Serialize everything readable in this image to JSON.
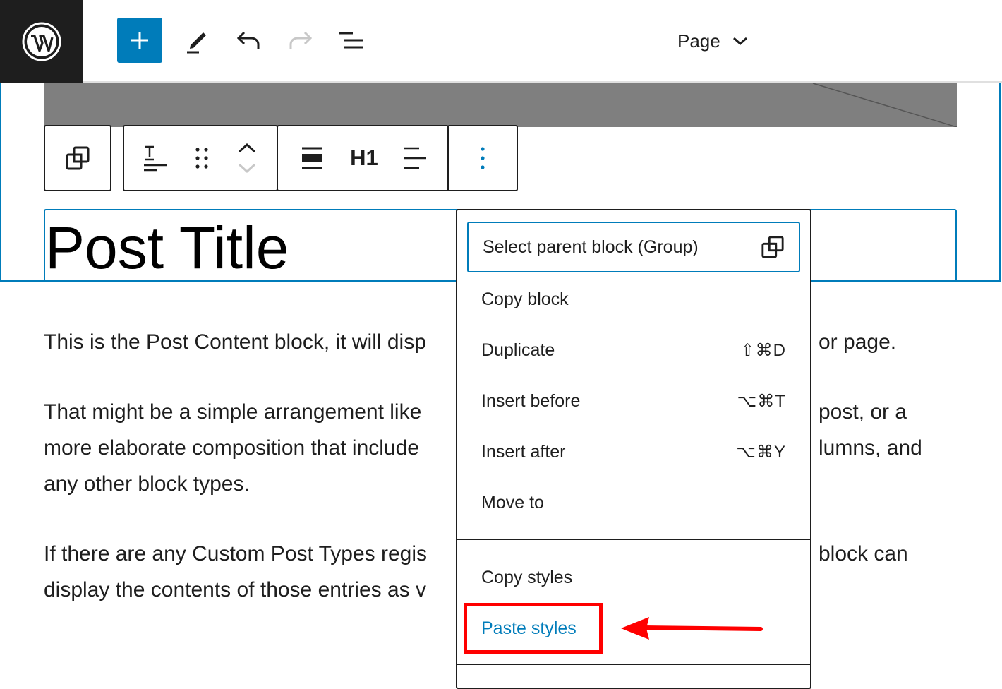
{
  "topbar": {
    "logo_name": "wordpress-logo",
    "add_icon": "plus-icon",
    "tools": [
      "pencil-icon",
      "undo-icon",
      "redo-icon",
      "list-view-icon"
    ],
    "page_label": "Page",
    "accent": "#007cba"
  },
  "block_toolbar": {
    "parent_icon": "select-parent-icon",
    "tools": [
      "transform-heading-icon",
      "drag-handle-icon",
      "move-up-down-icon",
      "align-wide-icon",
      "heading-level-icon",
      "text-align-icon",
      "more-options-icon"
    ],
    "heading_level": "H1"
  },
  "content": {
    "title": "Post Title",
    "paragraphs": [
      {
        "left": "This is the Post Content block, it will disp",
        "right": "or page."
      },
      {
        "left": "That might be a simple arrangement like",
        "right": "post, or a"
      },
      {
        "left": "more elaborate composition that include",
        "right": "lumns, and"
      },
      {
        "left": "any other block types.",
        "right": ""
      },
      {
        "left": "If there are any Custom Post Types regis",
        "right": "block can"
      },
      {
        "left": "display the contents of those entries as v",
        "right": ""
      }
    ]
  },
  "menu": {
    "items": [
      {
        "label": "Select parent block (Group)",
        "shortcut": ""
      },
      {
        "label": "Copy block",
        "shortcut": ""
      },
      {
        "label": "Duplicate",
        "shortcut": "⇧⌘D"
      },
      {
        "label": "Insert before",
        "shortcut": "⌥⌘T"
      },
      {
        "label": "Insert after",
        "shortcut": "⌥⌘Y"
      },
      {
        "label": "Move to",
        "shortcut": ""
      }
    ],
    "styles_items": [
      {
        "label": "Copy styles"
      },
      {
        "label": "Paste styles"
      }
    ]
  },
  "annotation": {
    "color": "#ff0000"
  }
}
